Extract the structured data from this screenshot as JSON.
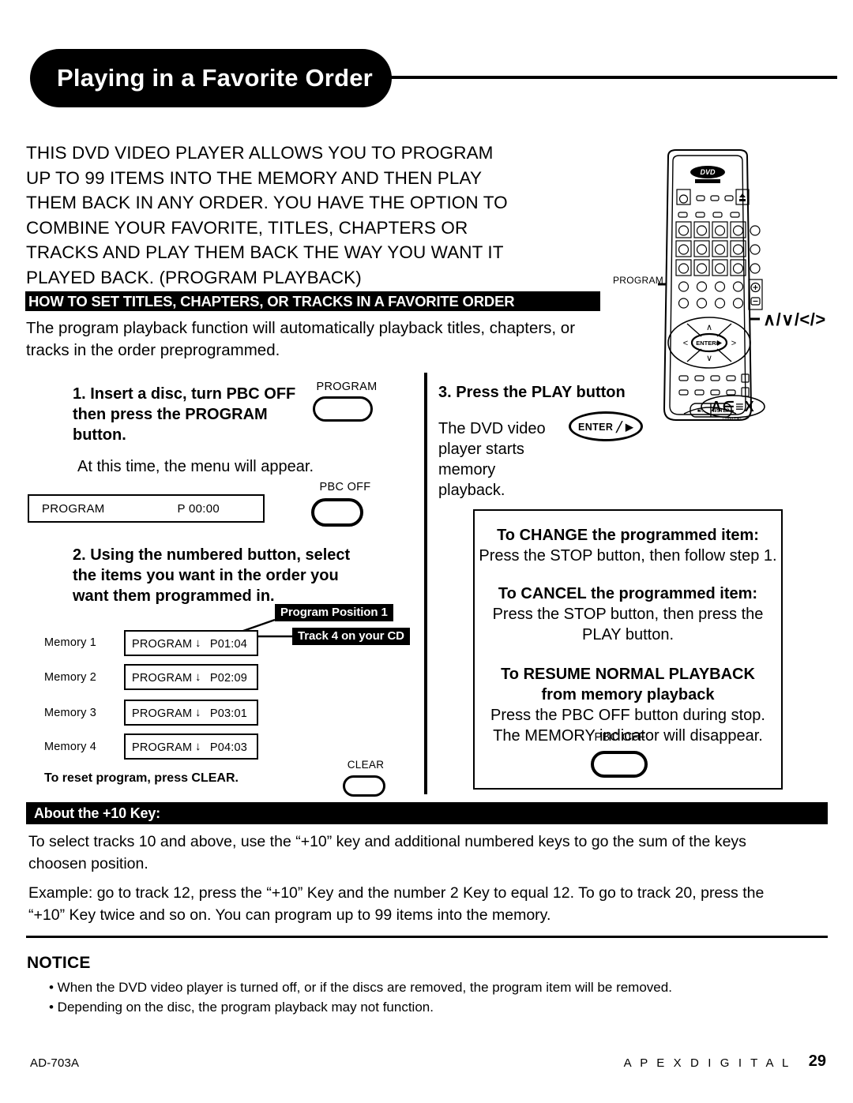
{
  "page": {
    "title": "Playing in a Favorite Order",
    "intro_lines": [
      "THIS DVD VIDEO PLAYER ALLOWS YOU TO PROGRAM",
      "UP TO 99 ITEMS INTO THE MEMORY AND THEN PLAY",
      "THEM BACK IN ANY ORDER.  YOU HAVE THE OPTION TO",
      "COMBINE YOUR FAVORITE, TITLES, CHAPTERS OR",
      "TRACKS AND PLAY THEM BACK THE WAY YOU WANT IT",
      "PLAYED BACK.  (PROGRAM PLAYBACK)"
    ]
  },
  "section": {
    "bar_title": "HOW TO SET TITLES, CHAPTERS, OR TRACKS IN A FAVORITE ORDER",
    "desc_lines": [
      "The program playback function will automatically playback titles, chapters, or",
      "tracks in the order preprogrammed."
    ]
  },
  "step1": {
    "heading": "1. Insert a disc, turn PBC OFF then press the PROGRAM button.",
    "note": "At this time, the menu will appear.",
    "program_key_label": "PROGRAM",
    "pbcoff_key_label": "PBC OFF",
    "display": {
      "left": "PROGRAM",
      "right": "P 00:00"
    }
  },
  "step2": {
    "heading": "2. Using the numbered button, select the items you want in the order you want them programmed in.",
    "memory_rows": [
      {
        "label": "Memory 1",
        "name": "PROGRAM",
        "arrow": "↓",
        "value": "P01:04"
      },
      {
        "label": "Memory 2",
        "name": "PROGRAM",
        "arrow": "↓",
        "value": "P02:09"
      },
      {
        "label": "Memory 3",
        "name": "PROGRAM",
        "arrow": "↓",
        "value": "P03:01"
      },
      {
        "label": "Memory 4",
        "name": "PROGRAM",
        "arrow": "↓",
        "value": "P04:03"
      }
    ],
    "callouts": {
      "position": "Program Position 1",
      "track": "Track 4 on your CD"
    },
    "reset_note": "To reset program, press CLEAR.",
    "clear_key_label": "CLEAR"
  },
  "step3": {
    "heading": "3. Press the PLAY button",
    "body_lines": [
      "The DVD video",
      "player starts",
      "memory",
      "playback."
    ],
    "enter_key_label": "ENTER ╱ ▶"
  },
  "info_box": {
    "change_head": "To CHANGE the programmed item:",
    "change_body": "Press the STOP button, then follow step 1.",
    "cancel_head": "To CANCEL the programmed item:",
    "cancel_body_lines": [
      "Press the STOP button, then press the",
      "PLAY button."
    ],
    "resume_head_lines": [
      "To RESUME NORMAL PLAYBACK",
      "from memory playback"
    ],
    "resume_body_lines": [
      "Press the PBC OFF button during stop.",
      "The MEMORY indicator will disappear."
    ],
    "pbcoff_key_label": "PBC OFF"
  },
  "plus10": {
    "bar_title": "About the +10 Key:",
    "paragraph1_lines": [
      "To select tracks 10 and above, use the “+10” key and additional numbered keys to go the sum of the keys",
      "choosen position."
    ],
    "paragraph2_lines": [
      "Example: go to track 12, press the “+10” Key and the number 2 Key to equal 12. To go to track 20, press the",
      "“+10” Key twice and so on. You can program up to 99 items into the memory."
    ]
  },
  "notice": {
    "heading": "NOTICE",
    "items": [
      "• When the DVD video player is turned off, or if the discs are removed, the program item will be removed.",
      "• Depending on the disc, the program playback may not function."
    ]
  },
  "footer": {
    "model": "AD-703A",
    "brand": "A P E X    D I G I T A L",
    "page_number": "29"
  },
  "remote": {
    "logo_top": "DVD",
    "logo_bottom": "VIDEO",
    "brand": "APEX",
    "brand_sub": "DIGITAL",
    "callout_program": "PROGRAM",
    "callout_arrows": "∧/∨/</>",
    "enter_label": "ENTER/▶"
  },
  "colors": {
    "ink": "#000000",
    "paper": "#ffffff"
  }
}
